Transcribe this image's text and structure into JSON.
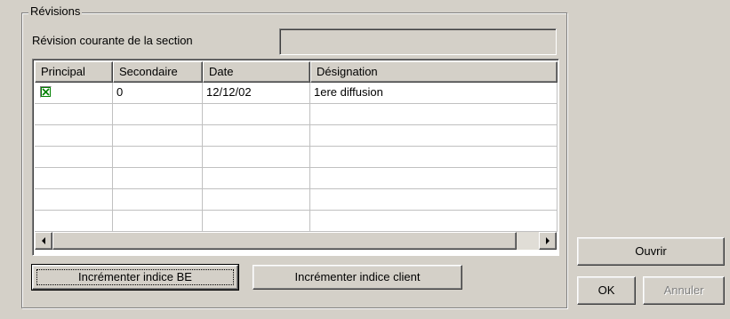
{
  "group_title": "Révisions",
  "current_revision_label": "Révision courante de la section",
  "current_revision_value": "",
  "table": {
    "columns": [
      "Principal",
      "Secondaire",
      "Date",
      "Désignation"
    ],
    "rows": [
      {
        "principal_checked": true,
        "secondaire": "0",
        "date": "12/12/02",
        "designation": "1ere diffusion"
      }
    ]
  },
  "buttons": {
    "incr_be": "Incrémenter indice BE",
    "incr_client": "Incrémenter indice client",
    "ouvrir": "Ouvrir",
    "ok": "OK",
    "annuler": "Annuler"
  },
  "colors": {
    "window_bg": "#d4d0c8",
    "check_mark": "#008000"
  }
}
